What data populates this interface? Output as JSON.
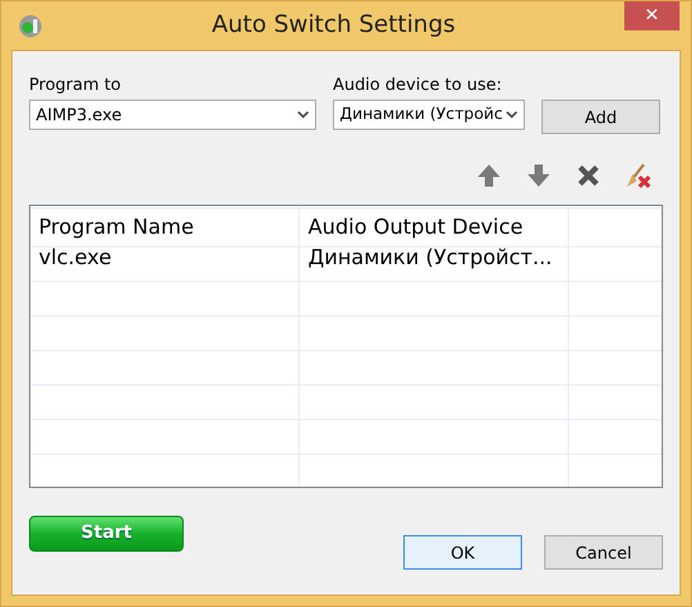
{
  "window": {
    "title": "Auto Switch Settings",
    "close": "✕"
  },
  "program_field": {
    "label": "Program to",
    "value": "AIMP3.exe"
  },
  "device_field": {
    "label": "Audio device to use:",
    "value": "Динамики (Устройс"
  },
  "add_button": "Add",
  "toolbar": [
    {
      "kind": "up"
    },
    {
      "kind": "down"
    },
    {
      "kind": "delete"
    },
    {
      "kind": "clear"
    }
  ],
  "table": {
    "columns": [
      "Program Name",
      "Audio Output Device"
    ],
    "rows": [
      [
        "vlc.exe",
        "Динамики (Устройст..."
      ]
    ]
  },
  "start_button": "Start",
  "buttons": [
    {
      "label": "OK",
      "focused": true
    },
    {
      "label": "Cancel",
      "focused": false
    }
  ]
}
